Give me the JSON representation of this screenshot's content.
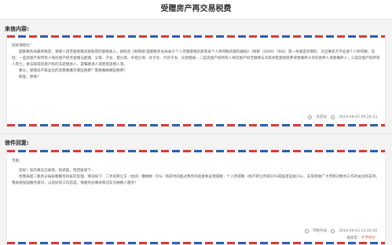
{
  "page": {
    "title": "受赠房产再交易税费"
  },
  "letter": {
    "section_label": "来信内容:",
    "greeting": "您好请帮忙!",
    "paragraph_1": "国家税务局最新规定，受赠人因无偿受赠房屋取得的受赠收入，按照合《财政部 国家税务总局关于个人无偿受赠房屋有关个人所得税问题的通知》（财税〔2009〕78号）第一条规定的情形，对当事双方不征收个人所得税，包括：一是房屋产权所有人将房屋产权无偿赠与配偶、父母、子女、祖父母、外祖父母、孙子女、外孙子女、兄弟姐妹；二是房屋产权所有人将房屋产权无偿赠与对其承担直接抚养或者赡养义务的抚养人或者赡养人；三是房屋产权所有人死亡，依法取得房屋产权的法定继承人、遗嘱继承人或者受遗赠人等。",
    "paragraph_2": "那么，受赠房产再卖出的话需要缴交哪些税费？需要缴纳哪些税费？",
    "closing": "盼复，感谢！",
    "author": "龙友好",
    "timestamp": "2019-08-05 09:28:23"
  },
  "reply": {
    "section_label": "信件回复:",
    "salutation": "市民：",
    "paragraph_1": "您好！您的来信已收悉。经调查，现回复如下：",
    "paragraph_2": "经我局第二税务分局核税服务科核实处理，情况如下：二手房转让方（住房）缴纳税（5%）购买时间超过两年的房屋免征增值税，个人所得税（财产转让所得20%或核定征收1%）。非常感谢广大市民对税务工作的关注和支持，我局将加强服务意识，以良好的工作态度，快捷的办事效率切实为纳税人服务！",
    "author": "市税务局",
    "timestamp": "2019-09-03 14:30:20",
    "satisfaction_label": "满意度：",
    "satisfaction_value": "不予评价"
  },
  "colors": {
    "airmail_red": "#d63b3b",
    "airmail_blue": "#2f5fa8",
    "satisfaction_accent": "#e05a2a"
  }
}
